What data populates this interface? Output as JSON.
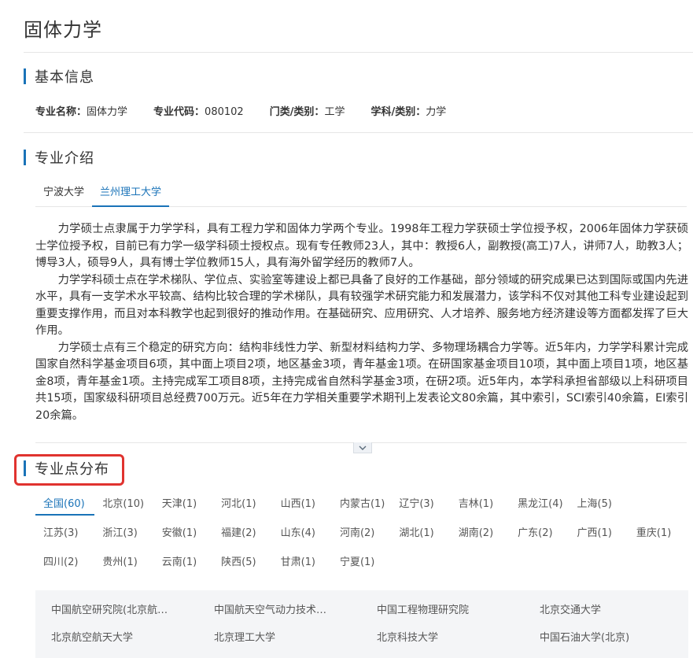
{
  "page": {
    "title": "固体力学"
  },
  "basic_info": {
    "heading": "基本信息",
    "items": [
      {
        "key": "专业名称：",
        "value": "固体力学"
      },
      {
        "key": "专业代码：",
        "value": "080102"
      },
      {
        "key": "门类/类别：",
        "value": "工学"
      },
      {
        "key": "学科/类别：",
        "value": "力学"
      }
    ]
  },
  "intro": {
    "heading": "专业介绍",
    "tabs": [
      {
        "label": "宁波大学"
      },
      {
        "label": "兰州理工大学"
      }
    ],
    "paragraphs": [
      "力学硕士点隶属于力学学科，具有工程力学和固体力学两个专业。1998年工程力学获硕士学位授予权，2006年固体力学获硕士学位授予权，目前已有力学一级学科硕士授权点。现有专任教师23人，其中：教授6人，副教授(高工)7人，讲师7人，助教3人；博导3人，硕导9人，具有博士学位教师15人，具有海外留学经历的教师7人。",
      "力学学科硕士点在学术梯队、学位点、实验室等建设上都已具备了良好的工作基础，部分领域的研究成果已达到国际或国内先进水平，具有一支学术水平较高、结构比较合理的学术梯队，具有较强学术研究能力和发展潜力，该学科不仅对其他工科专业建设起到重要支撑作用，而且对本科教学也起到很好的推动作用。在基础研究、应用研究、人才培养、服务地方经济建设等方面都发挥了巨大作用。",
      "力学硕士点有三个稳定的研究方向：结构非线性力学、新型材料结构力学、多物理场耦合力学等。近5年内，力学学科累计完成国家自然科学基金项目6项，其中面上项目2项，地区基金3项，青年基金1项。在研国家基金项目10项，其中面上项目1项，地区基金8项，青年基金1项。主持完成军工项目8项，主持完成省自然科学基金3项，在研2项。近5年内，本学科承担省部级以上科研项目共15项，国家级科研项目总经费700万元。近5年在力学相关重要学术期刊上发表论文80余篇，其中索引，SCI索引40余篇，EI索引20余篇。"
    ]
  },
  "distribution": {
    "heading": "专业点分布",
    "regions": [
      [
        "全国(60)",
        "北京(10)",
        "天津(1)",
        "河北(1)",
        "山西(1)",
        "内蒙古(1)",
        "辽宁(3)",
        "吉林(1)",
        "黑龙江(4)",
        "上海(5)"
      ],
      [
        "江苏(3)",
        "浙江(3)",
        "安徽(1)",
        "福建(2)",
        "山东(4)",
        "河南(2)",
        "湖北(1)",
        "湖南(2)",
        "广东(2)",
        "广西(1)",
        "重庆(1)"
      ],
      [
        "四川(2)",
        "贵州(1)",
        "云南(1)",
        "陕西(5)",
        "甘肃(1)",
        "宁夏(1)"
      ]
    ],
    "schools": [
      "中国航空研究院(北京航…",
      "中国航天空气动力技术…",
      "中国工程物理研究院",
      "北京交通大学",
      "北京航空航天大学",
      "北京理工大学",
      "北京科技大学",
      "中国石油大学(北京)"
    ]
  },
  "colors": {
    "accent": "#1a73b8",
    "highlight": "#e0332f"
  },
  "icons": {
    "expand": "chevron-down-icon"
  }
}
